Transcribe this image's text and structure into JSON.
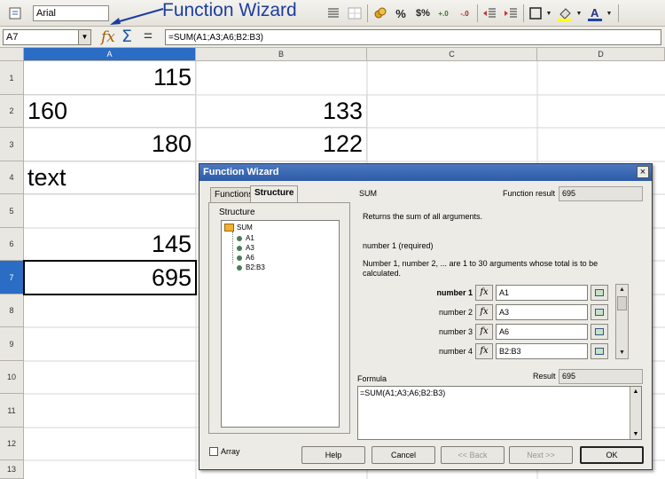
{
  "toolbar": {
    "font_name": "Arial",
    "callout_text": "Function Wizard"
  },
  "formula_bar": {
    "cell_ref": "A7",
    "formula": "=SUM(A1;A3;A6;B2:B3)",
    "fx_symbol": "fx",
    "sigma_symbol": "Σ",
    "equals_symbol": "="
  },
  "sheet": {
    "columns": [
      "A",
      "B",
      "C",
      "D"
    ],
    "rows": [
      "1",
      "2",
      "3",
      "4",
      "5",
      "6",
      "7",
      "8",
      "9",
      "10",
      "11",
      "12",
      "13"
    ],
    "cells": {
      "A1": "115",
      "A2": "160",
      "A3": "180",
      "A4": "text",
      "A6": "145",
      "A7": "695",
      "B2": "133",
      "B3": "122"
    }
  },
  "dialog": {
    "title": "Function Wizard",
    "close_symbol": "×",
    "tabs": [
      "Functions",
      "Structure"
    ],
    "structure_label": "Structure",
    "tree": {
      "root": "SUM",
      "children": [
        "A1",
        "A3",
        "A6",
        "B2:B3"
      ]
    },
    "function_name": "SUM",
    "function_result_label": "Function result",
    "function_result": "695",
    "description": "Returns the sum of all arguments.",
    "arg_heading": "number 1 (required)",
    "arg_description": "Number 1, number 2, ... are 1 to 30 arguments whose total is to be calculated.",
    "args": [
      {
        "label": "number 1",
        "value": "A1"
      },
      {
        "label": "number 2",
        "value": "A3"
      },
      {
        "label": "number 3",
        "value": "A6"
      },
      {
        "label": "number 4",
        "value": "B2:B3"
      }
    ],
    "formula_label": "Formula",
    "result_label": "Result",
    "result_value": "695",
    "formula_text": "=SUM(A1;A3;A6;B2:B3)",
    "array_label": "Array",
    "buttons": {
      "help": "Help",
      "cancel": "Cancel",
      "back": "<< Back",
      "next": "Next >>",
      "ok": "OK"
    }
  }
}
